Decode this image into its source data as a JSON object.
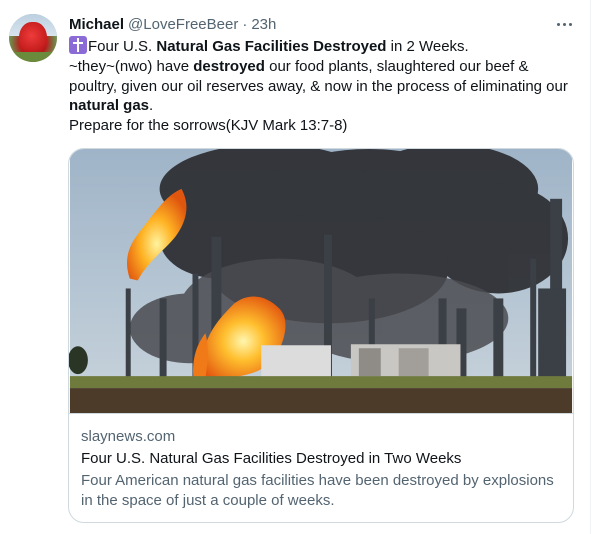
{
  "tweet": {
    "author_name": "Michael",
    "author_handle": "@LoveFreeBeer",
    "separator": "·",
    "time": "23h",
    "text": {
      "l1_a": "Four U.S. ",
      "l1_b": "Natural Gas Facilities Destroyed",
      "l1_c": " in 2 Weeks.",
      "l2_a": "~they~(nwo) have ",
      "l2_b": "destroyed",
      "l2_c": " our food plants, slaughtered our beef &",
      "l3": "poultry, given our oil reserves away, & now in the process of eliminating our",
      "l4_a": "natural gas",
      "l4_b": ".",
      "l5": "Prepare for the sorrows(KJV Mark 13:7-8)"
    },
    "emoji": "latin-cross-emoji",
    "more_icon": "ellipsis-icon"
  },
  "card": {
    "domain": "slaynews.com",
    "title": "Four U.S. Natural Gas Facilities Destroyed in Two Weeks",
    "description_l1": "Four American natural gas facilities have been destroyed by explosions",
    "description_l2": "in the space of just a couple of weeks."
  },
  "colors": {
    "text_primary": "#0f1419",
    "text_secondary": "#536471",
    "border": "#cfd9de"
  }
}
